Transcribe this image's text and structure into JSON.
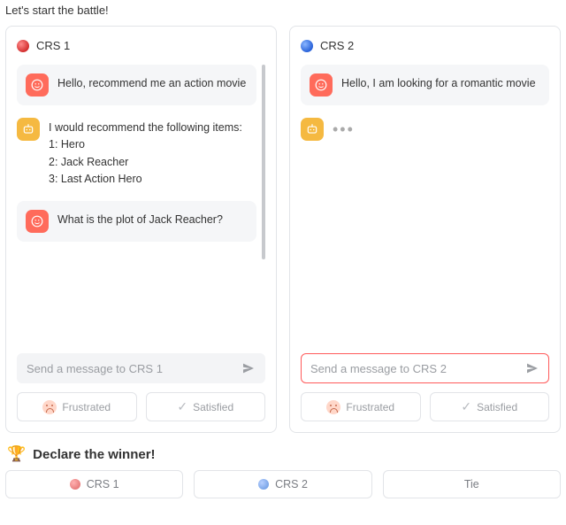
{
  "header": "Let's start the battle!",
  "panels": {
    "left": {
      "title": "CRS 1",
      "messages": {
        "m0": "Hello, recommend me an action movie",
        "m1_intro": "I would recommend the following items:",
        "m1_r1": "1: Hero",
        "m1_r2": "2: Jack Reacher",
        "m1_r3": "3: Last Action Hero",
        "m2": "What is the plot of Jack Reacher?"
      },
      "input_placeholder": "Send a message to CRS 1"
    },
    "right": {
      "title": "CRS 2",
      "messages": {
        "m0": "Hello, I am looking for a romantic movie"
      },
      "input_placeholder": "Send a message to CRS 2"
    }
  },
  "feedback": {
    "frustrated": "Frustrated",
    "satisfied": "Satisfied"
  },
  "declare": {
    "heading": "Declare the winner!",
    "crs1": "CRS 1",
    "crs2": "CRS 2",
    "tie": "Tie"
  }
}
